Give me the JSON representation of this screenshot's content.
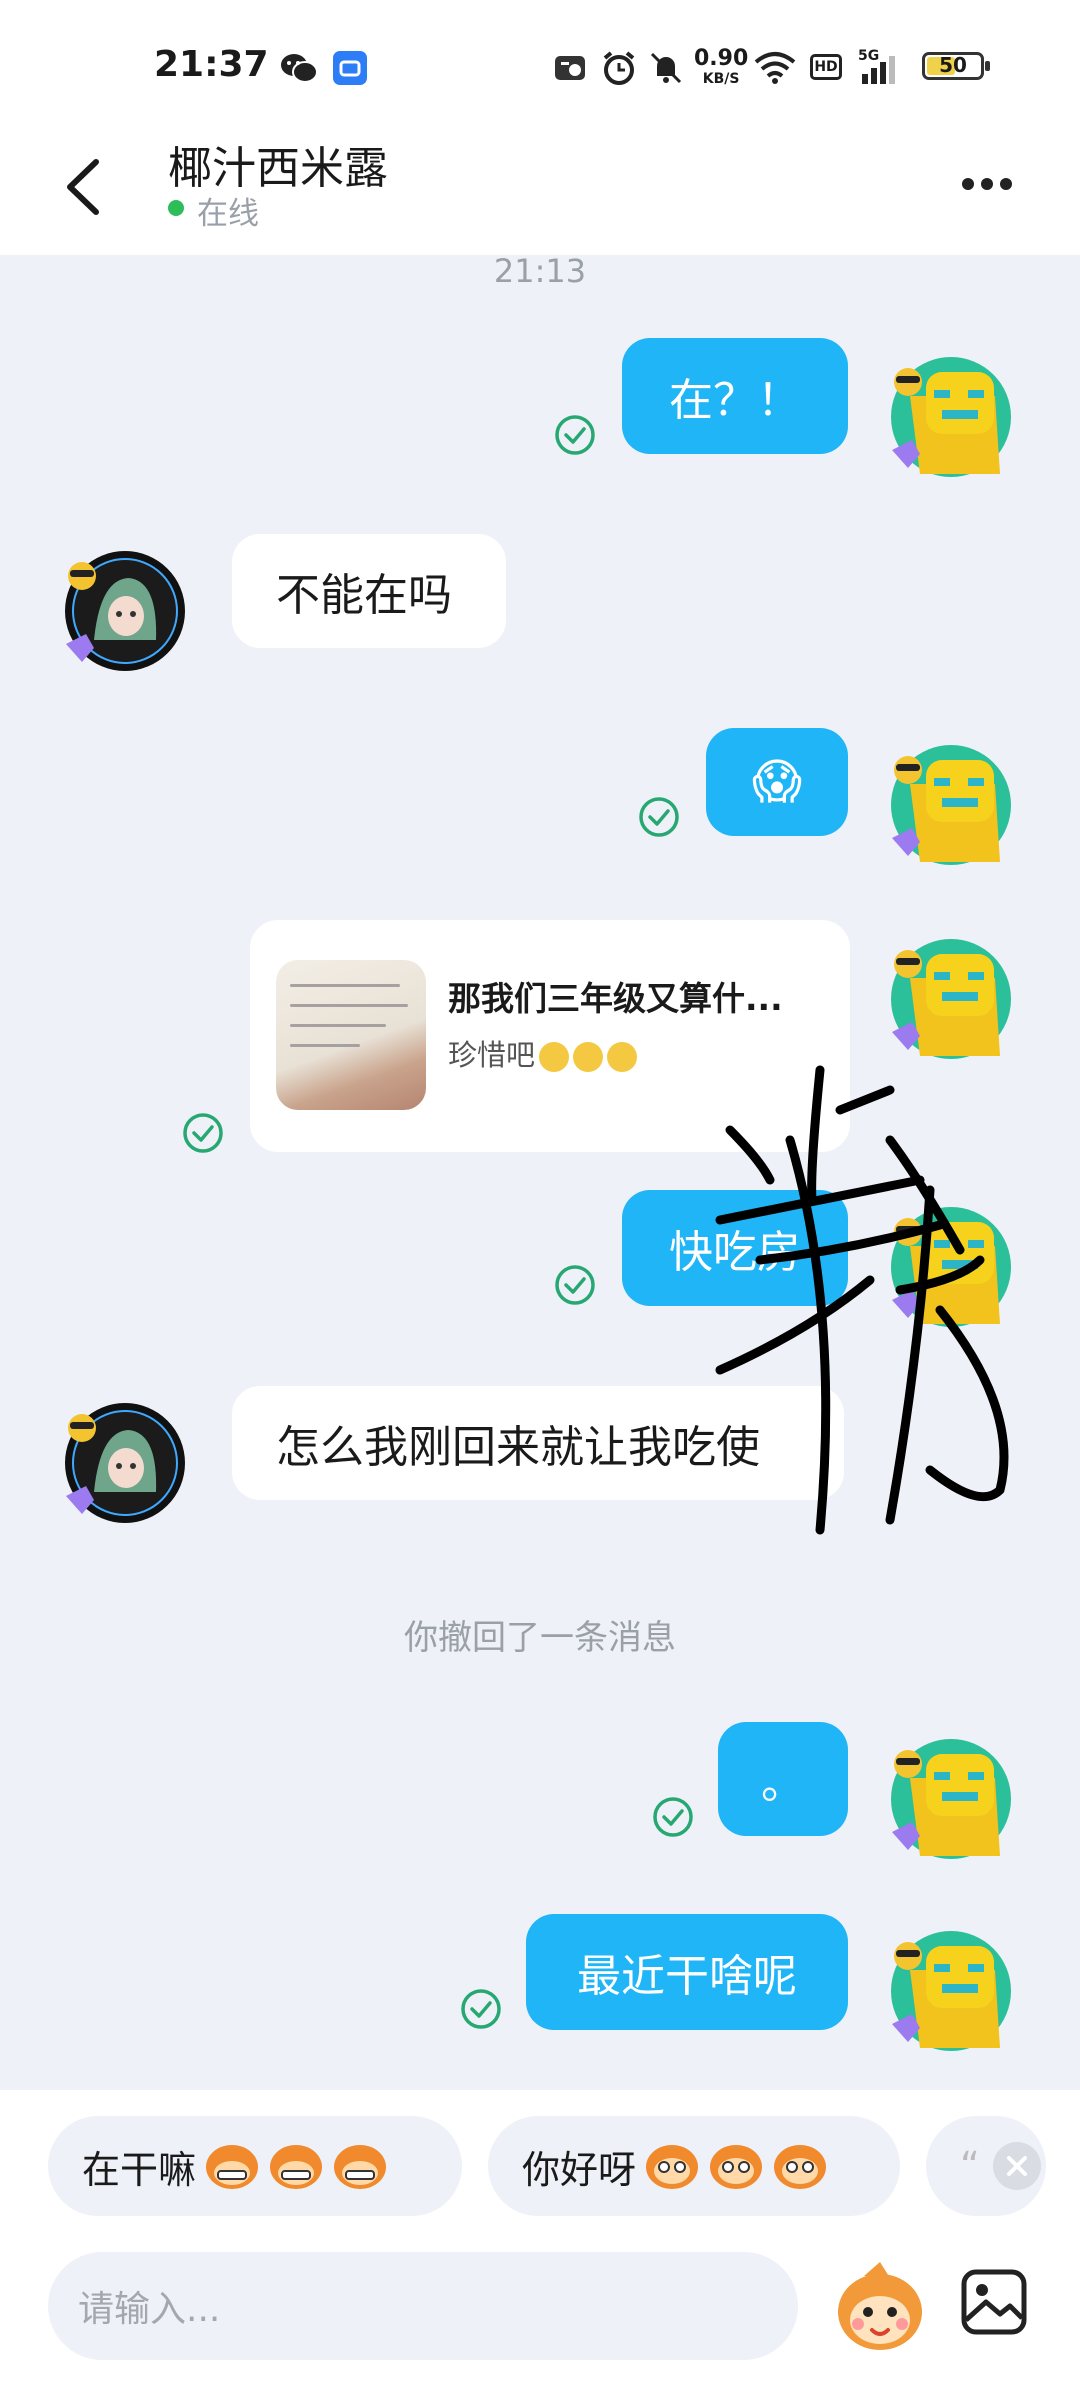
{
  "status_bar": {
    "time": "21:37",
    "net_speed": "0.90",
    "net_unit": "KB/S",
    "hd_label": "HD",
    "signal_label": "5G",
    "battery": "50",
    "icons": [
      "wechat-icon",
      "notification-app-icon",
      "nfc-icon",
      "alarm-icon",
      "mute-icon",
      "wifi-icon",
      "hd-icon",
      "signal-icon",
      "battery-icon"
    ]
  },
  "header": {
    "contact_name": "椰汁西米露",
    "status": "在线",
    "status_color": "#2dbd5a"
  },
  "chat": {
    "timestamp": "21:13",
    "messages": [
      {
        "dir": "out",
        "text": "在？！"
      },
      {
        "dir": "in",
        "text": "不能在吗"
      },
      {
        "dir": "out",
        "text": "😱"
      },
      {
        "dir": "out",
        "type": "card",
        "title": "那我们三年级又算什...",
        "subtitle": "珍惜吧"
      },
      {
        "dir": "out",
        "text": "快吃房"
      },
      {
        "dir": "in",
        "text": "怎么我刚回来就让我吃使"
      },
      {
        "dir": "out",
        "text": "。"
      },
      {
        "dir": "out",
        "text": "最近干啥呢"
      }
    ],
    "system_note": "你撤回了一条消息"
  },
  "quick_replies": [
    {
      "text": "在干嘛"
    },
    {
      "text": "你好呀"
    },
    {
      "text": "“"
    }
  ],
  "composer": {
    "placeholder": "请输入..."
  },
  "colors": {
    "outgoing_bubble": "#1fb5f6",
    "incoming_bubble": "#ffffff",
    "background": "#eef1f7",
    "read_check": "#27a872"
  }
}
